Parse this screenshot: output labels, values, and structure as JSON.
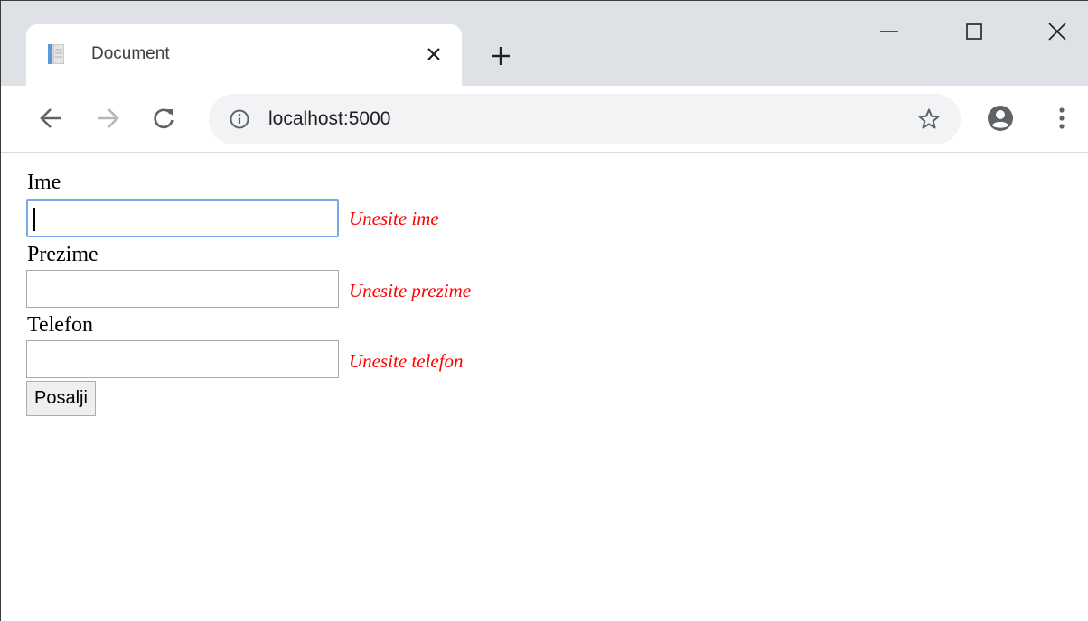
{
  "browser": {
    "tab": {
      "title": "Document"
    },
    "address_bar": {
      "url": "localhost:5000"
    }
  },
  "form": {
    "fields": [
      {
        "label": "Ime",
        "value": "",
        "error": "Unesite ime"
      },
      {
        "label": "Prezime",
        "value": "",
        "error": "Unesite prezime"
      },
      {
        "label": "Telefon",
        "value": "",
        "error": "Unesite telefon"
      }
    ],
    "submit_label": "Posalji"
  },
  "colors": {
    "error_text": "#ff0000",
    "focus_border": "#7aa7e8",
    "tabstrip_bg": "#dee1e6",
    "omnibox_bg": "#f1f3f4"
  }
}
